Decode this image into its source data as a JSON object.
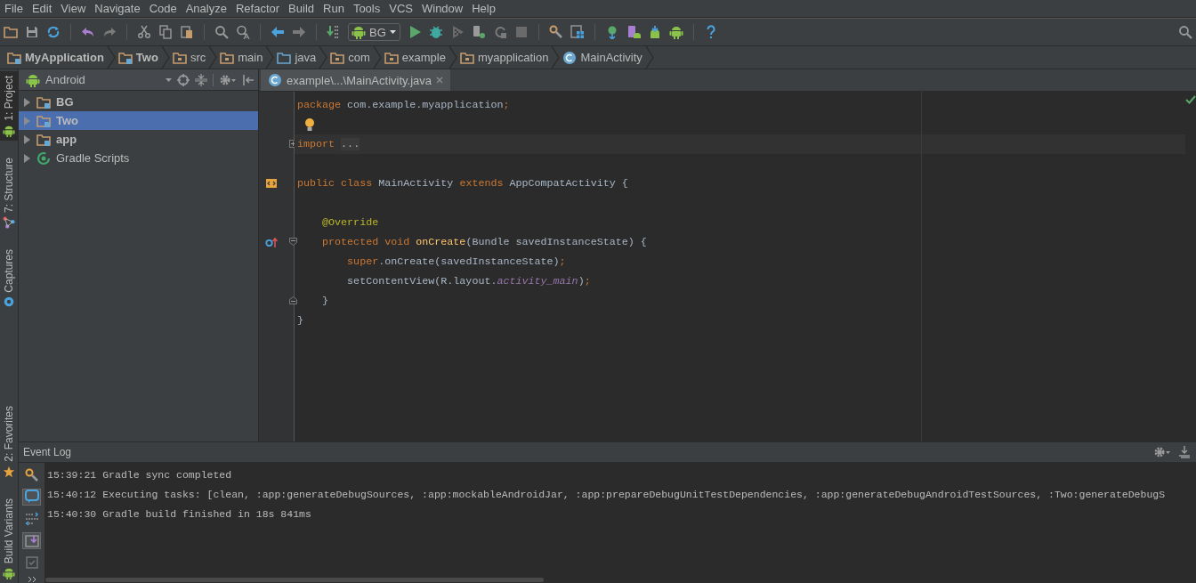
{
  "menu": [
    "File",
    "Edit",
    "View",
    "Navigate",
    "Code",
    "Analyze",
    "Refactor",
    "Build",
    "Run",
    "Tools",
    "VCS",
    "Window",
    "Help"
  ],
  "toolbar": {
    "run_config": "BG"
  },
  "breadcrumbs": [
    {
      "label": "MyApplication",
      "kind": "module"
    },
    {
      "label": "Two",
      "kind": "module"
    },
    {
      "label": "src",
      "kind": "folder"
    },
    {
      "label": "main",
      "kind": "folder"
    },
    {
      "label": "java",
      "kind": "source-folder"
    },
    {
      "label": "com",
      "kind": "folder"
    },
    {
      "label": "example",
      "kind": "folder"
    },
    {
      "label": "myapplication",
      "kind": "folder"
    },
    {
      "label": "MainActivity",
      "kind": "class"
    }
  ],
  "left_stripe": {
    "top": [
      {
        "label": "1: Project",
        "kind": "project",
        "selected": true
      },
      {
        "label": "7: Structure",
        "kind": "structure",
        "selected": false
      },
      {
        "label": "Captures",
        "kind": "captures",
        "selected": false
      }
    ],
    "bottom": [
      {
        "label": "2: Favorites",
        "kind": "favorites",
        "selected": false
      },
      {
        "label": "Build Variants",
        "kind": "build-variants",
        "selected": false
      }
    ]
  },
  "project": {
    "view": "Android",
    "tree": [
      {
        "label": "BG",
        "kind": "module",
        "expanded": false,
        "selected": false
      },
      {
        "label": "Two",
        "kind": "module",
        "expanded": false,
        "selected": true
      },
      {
        "label": "app",
        "kind": "module",
        "expanded": false,
        "selected": false
      },
      {
        "label": "Gradle Scripts",
        "kind": "gradle",
        "expanded": false,
        "selected": false
      }
    ]
  },
  "editor": {
    "tabs": [
      {
        "label": "example\\...\\MainActivity.java",
        "selected": true
      }
    ],
    "lines": [
      {
        "kind": "code",
        "current": false,
        "tokens": [
          {
            "text": "package ",
            "kind": "keyword"
          },
          {
            "text": "com.example.myapplication",
            "kind": "plain"
          },
          {
            "text": ";",
            "kind": "keyword"
          }
        ]
      },
      {
        "kind": "hint",
        "current": false
      },
      {
        "kind": "folded-import",
        "current": true,
        "tokens": [
          {
            "text": "import ",
            "kind": "keyword"
          },
          {
            "text": "...",
            "kind": "folded"
          }
        ]
      },
      {
        "kind": "blank",
        "current": false
      },
      {
        "kind": "class-declaration",
        "current": false,
        "tokens": [
          {
            "text": "public class ",
            "kind": "keyword"
          },
          {
            "text": "MainActivity ",
            "kind": "plain"
          },
          {
            "text": "extends ",
            "kind": "keyword"
          },
          {
            "text": "AppCompatActivity {",
            "kind": "plain"
          }
        ]
      },
      {
        "kind": "blank",
        "current": false
      },
      {
        "kind": "code",
        "current": false,
        "tokens": [
          {
            "text": "    @Override",
            "kind": "annotation"
          }
        ]
      },
      {
        "kind": "method-declaration",
        "current": false,
        "tokens": [
          {
            "text": "    protected void ",
            "kind": "keyword"
          },
          {
            "text": "onCreate",
            "kind": "method"
          },
          {
            "text": "(Bundle savedInstanceState) {",
            "kind": "plain"
          }
        ]
      },
      {
        "kind": "code",
        "current": false,
        "tokens": [
          {
            "text": "        super",
            "kind": "keyword"
          },
          {
            "text": ".onCreate(savedInstanceState)",
            "kind": "plain"
          },
          {
            "text": ";",
            "kind": "keyword"
          }
        ]
      },
      {
        "kind": "code",
        "current": false,
        "tokens": [
          {
            "text": "        setContentView(R.layout.",
            "kind": "plain"
          },
          {
            "text": "activity_main",
            "kind": "field"
          },
          {
            "text": ")",
            "kind": "plain"
          },
          {
            "text": ";",
            "kind": "keyword"
          }
        ]
      },
      {
        "kind": "block-end",
        "current": false,
        "tokens": [
          {
            "text": "    }",
            "kind": "plain"
          }
        ]
      },
      {
        "kind": "code",
        "current": false,
        "tokens": [
          {
            "text": "}",
            "kind": "plain"
          }
        ]
      }
    ]
  },
  "event_log": {
    "title": "Event Log",
    "entries": [
      {
        "time": "15:39:21",
        "message": "Gradle sync completed"
      },
      {
        "time": "15:40:12",
        "message": "Executing tasks: [clean, :app:generateDebugSources, :app:mockableAndroidJar, :app:prepareDebugUnitTestDependencies, :app:generateDebugAndroidTestSources, :Two:generateDebugS"
      },
      {
        "time": "15:40:30",
        "message": "Gradle build finished in 18s 841ms"
      }
    ]
  }
}
